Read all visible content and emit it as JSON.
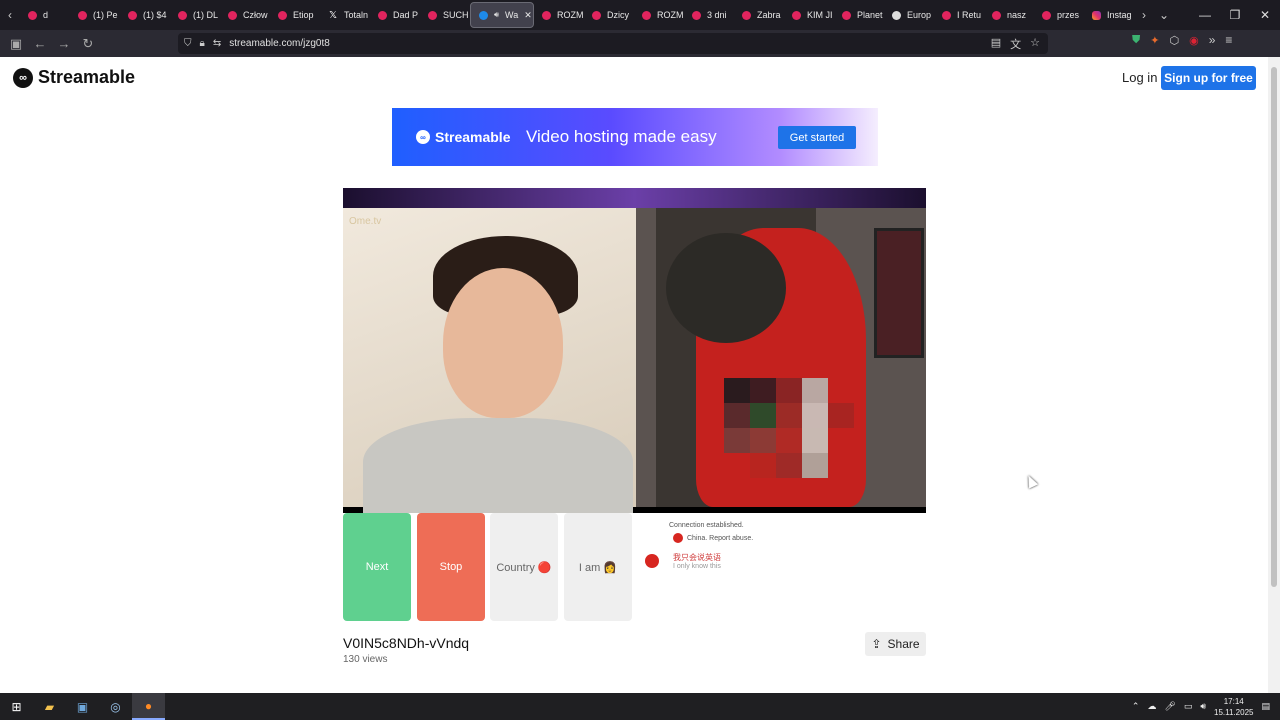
{
  "browser": {
    "tabs": [
      {
        "label": "d",
        "icon": "youtube-icon"
      },
      {
        "label": "(1) Pe",
        "icon": "youtube-icon"
      },
      {
        "label": "(1) $4",
        "icon": "youtube-icon"
      },
      {
        "label": "(1) DL",
        "icon": "youtube-icon"
      },
      {
        "label": "Człow",
        "icon": "youtube-icon"
      },
      {
        "label": "Etiop",
        "icon": "youtube-icon"
      },
      {
        "label": "Totaln",
        "icon": "x-icon"
      },
      {
        "label": "Dad P",
        "icon": "youtube-icon"
      },
      {
        "label": "SUCH",
        "icon": "youtube-icon"
      },
      {
        "label": "Wa",
        "icon": "streamable-icon",
        "active": true
      },
      {
        "label": "ROZM",
        "icon": "youtube-icon"
      },
      {
        "label": "Dzicy",
        "icon": "youtube-icon"
      },
      {
        "label": "ROZM",
        "icon": "youtube-icon"
      },
      {
        "label": "3 dni",
        "icon": "youtube-icon"
      },
      {
        "label": "Zabra",
        "icon": "youtube-icon"
      },
      {
        "label": "KIM JI",
        "icon": "youtube-icon"
      },
      {
        "label": "Planet",
        "icon": "youtube-icon"
      },
      {
        "label": "Europ",
        "icon": "globe-icon"
      },
      {
        "label": "I Retu",
        "icon": "youtube-icon"
      },
      {
        "label": "nasz",
        "icon": "youtube-icon"
      },
      {
        "label": "przes",
        "icon": "youtube-icon"
      },
      {
        "label": "Instag",
        "icon": "instagram-icon"
      }
    ],
    "url": "streamable.com/jzg0t8"
  },
  "site": {
    "brand": "Streamable",
    "login": "Log in",
    "signup": "Sign up for free"
  },
  "banner": {
    "brand": "Streamable",
    "tagline": "Video hosting made easy",
    "cta": "Get started"
  },
  "video": {
    "watermark": "Ome.tv",
    "buttons": {
      "next": "Next",
      "stop": "Stop",
      "country": "Country 🔴",
      "iam": "I am 👩"
    },
    "chat": {
      "line1": "Connection established.",
      "line2": "China. Report abuse.",
      "line3": "我只会说英语",
      "line4": "I only know this"
    },
    "title": "V0IN5c8NDh-vVndq",
    "views": "130 views",
    "share": "Share"
  },
  "taskbar": {
    "time": "17:14",
    "date": "15.11.2025"
  }
}
